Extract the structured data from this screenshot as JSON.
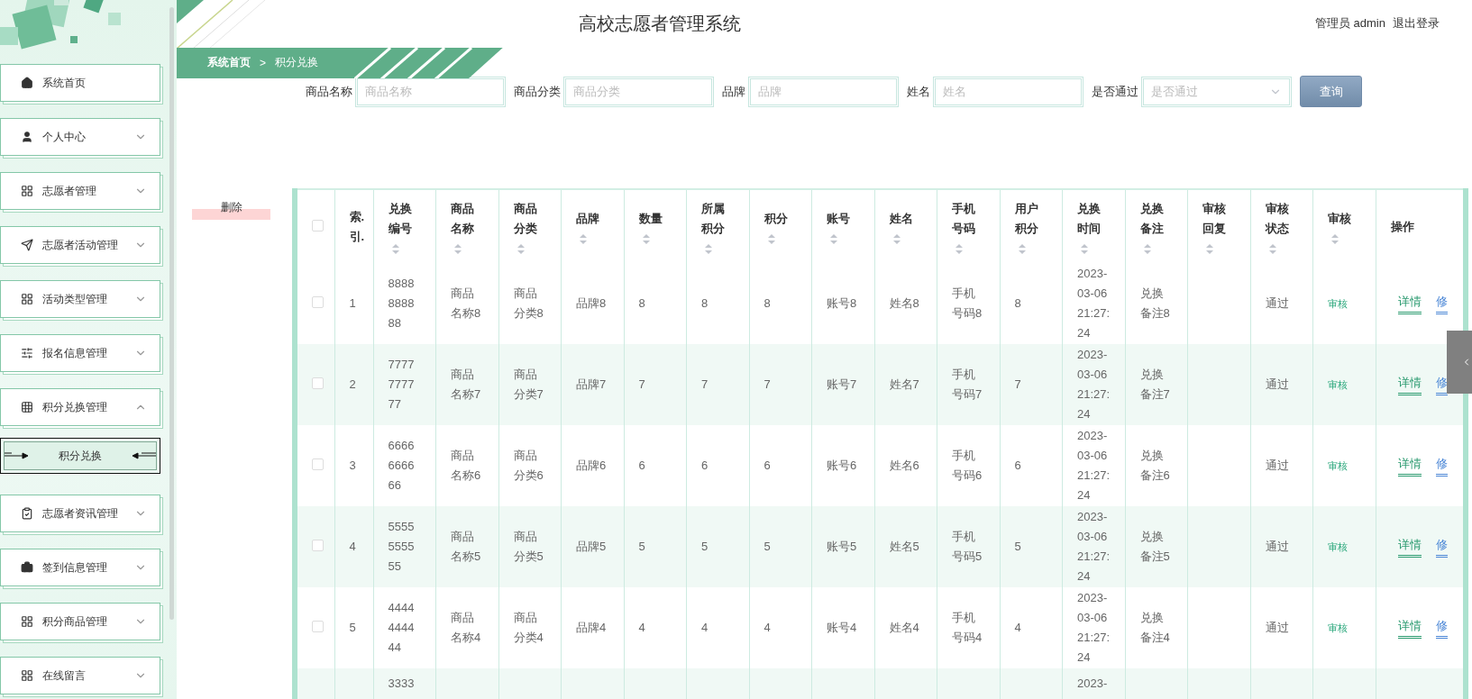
{
  "sidebar": {
    "items": [
      {
        "label": "系统首页",
        "kind": "link"
      },
      {
        "label": "个人中心",
        "kind": "menu",
        "expanded": false
      },
      {
        "label": "志愿者管理",
        "kind": "menu",
        "expanded": false
      },
      {
        "label": "志愿者活动管理",
        "kind": "menu",
        "expanded": false
      },
      {
        "label": "活动类型管理",
        "kind": "menu",
        "expanded": false
      },
      {
        "label": "报名信息管理",
        "kind": "menu",
        "expanded": false
      },
      {
        "label": "积分兑换管理",
        "kind": "menu",
        "expanded": true,
        "children": [
          {
            "label": "积分兑换",
            "selected": true
          }
        ]
      },
      {
        "label": "志愿者资讯管理",
        "kind": "menu",
        "expanded": false
      },
      {
        "label": "签到信息管理",
        "kind": "menu",
        "expanded": false
      },
      {
        "label": "积分商品管理",
        "kind": "menu",
        "expanded": false
      },
      {
        "label": "在线留言",
        "kind": "menu",
        "expanded": false
      }
    ]
  },
  "header": {
    "title": "高校志愿者管理系统",
    "user": "管理员 admin",
    "logout": "退出登录"
  },
  "breadcrumb": {
    "items": [
      "系统首页",
      "积分兑换"
    ],
    "separator": ">"
  },
  "search": {
    "fields": [
      {
        "label": "商品名称",
        "placeholder": "商品名称",
        "kind": "text"
      },
      {
        "label": "商品分类",
        "placeholder": "商品分类",
        "kind": "text"
      },
      {
        "label": "品牌",
        "placeholder": "品牌",
        "kind": "text"
      },
      {
        "label": "姓名",
        "placeholder": "姓名",
        "kind": "text"
      },
      {
        "label": "是否通过",
        "placeholder": "是否通过",
        "kind": "select"
      }
    ],
    "button": "查询"
  },
  "delete_button": "删除",
  "table": {
    "select_all": {
      "checked": false
    },
    "columns": [
      {
        "label": "索.引.",
        "kind": "index",
        "sortable": false
      },
      {
        "label": "兑换编号",
        "kind": "code",
        "sortable": true
      },
      {
        "label": "商品名称",
        "kind": "text",
        "sortable": true
      },
      {
        "label": "商品分类",
        "kind": "text",
        "sortable": true
      },
      {
        "label": "品牌",
        "kind": "text",
        "sortable": true
      },
      {
        "label": "数量",
        "kind": "text",
        "sortable": true
      },
      {
        "label": "所属积分",
        "kind": "text",
        "sortable": true
      },
      {
        "label": "积分",
        "kind": "text",
        "sortable": true
      },
      {
        "label": "账号",
        "kind": "text",
        "sortable": true
      },
      {
        "label": "姓名",
        "kind": "text",
        "sortable": true
      },
      {
        "label": "手机号码",
        "kind": "text",
        "sortable": true
      },
      {
        "label": "用户积分",
        "kind": "text",
        "sortable": true
      },
      {
        "label": "兑换时间",
        "kind": "time",
        "sortable": true
      },
      {
        "label": "兑换备注",
        "kind": "text",
        "sortable": true
      },
      {
        "label": "审核回复",
        "kind": "text",
        "sortable": true
      },
      {
        "label": "审核状态",
        "kind": "text",
        "sortable": true
      },
      {
        "label": "审核",
        "kind": "link",
        "sortable": true
      },
      {
        "label": "操作",
        "kind": "actions",
        "sortable": false
      }
    ],
    "rows": [
      {
        "kind": "full",
        "checked": false,
        "cells": [
          "1",
          "8888888888",
          "商品名称8",
          "商品分类8",
          "品牌8",
          "8",
          "8",
          "8",
          "账号8",
          "姓名8",
          "手机号码8",
          "8",
          "2023-03-06 21:27:24",
          "兑换备注8",
          null,
          "通过",
          "审核"
        ],
        "actions": [
          "详情",
          "修"
        ]
      },
      {
        "kind": "full",
        "checked": false,
        "cells": [
          "2",
          "7777777777",
          "商品名称7",
          "商品分类7",
          "品牌7",
          "7",
          "7",
          "7",
          "账号7",
          "姓名7",
          "手机号码7",
          "7",
          "2023-03-06 21:27:24",
          "兑换备注7",
          null,
          "通过",
          "审核"
        ],
        "actions": [
          "详情",
          "修"
        ]
      },
      {
        "kind": "full",
        "checked": false,
        "cells": [
          "3",
          "6666666666",
          "商品名称6",
          "商品分类6",
          "品牌6",
          "6",
          "6",
          "6",
          "账号6",
          "姓名6",
          "手机号码6",
          "6",
          "2023-03-06 21:27:24",
          "兑换备注6",
          null,
          "通过",
          "审核"
        ],
        "actions": [
          "详情",
          "修"
        ]
      },
      {
        "kind": "full",
        "checked": false,
        "cells": [
          "4",
          "5555555555",
          "商品名称5",
          "商品分类5",
          "品牌5",
          "5",
          "5",
          "5",
          "账号5",
          "姓名5",
          "手机号码5",
          "5",
          "2023-03-06 21:27:24",
          "兑换备注5",
          null,
          "通过",
          "审核"
        ],
        "actions": [
          "详情",
          "修"
        ]
      },
      {
        "kind": "full",
        "checked": false,
        "cells": [
          "5",
          "4444444444",
          "商品名称4",
          "商品分类4",
          "品牌4",
          "4",
          "4",
          "4",
          "账号4",
          "姓名4",
          "手机号码4",
          "4",
          "2023-03-06 21:27:24",
          "兑换备注4",
          null,
          "通过",
          "审核"
        ],
        "actions": [
          "详情",
          "修"
        ]
      },
      {
        "kind": "partial",
        "cells": [
          null,
          "3333",
          null,
          null,
          null,
          null,
          null,
          null,
          null,
          null,
          null,
          null,
          "2023-",
          null,
          null,
          null,
          null
        ]
      }
    ]
  }
}
